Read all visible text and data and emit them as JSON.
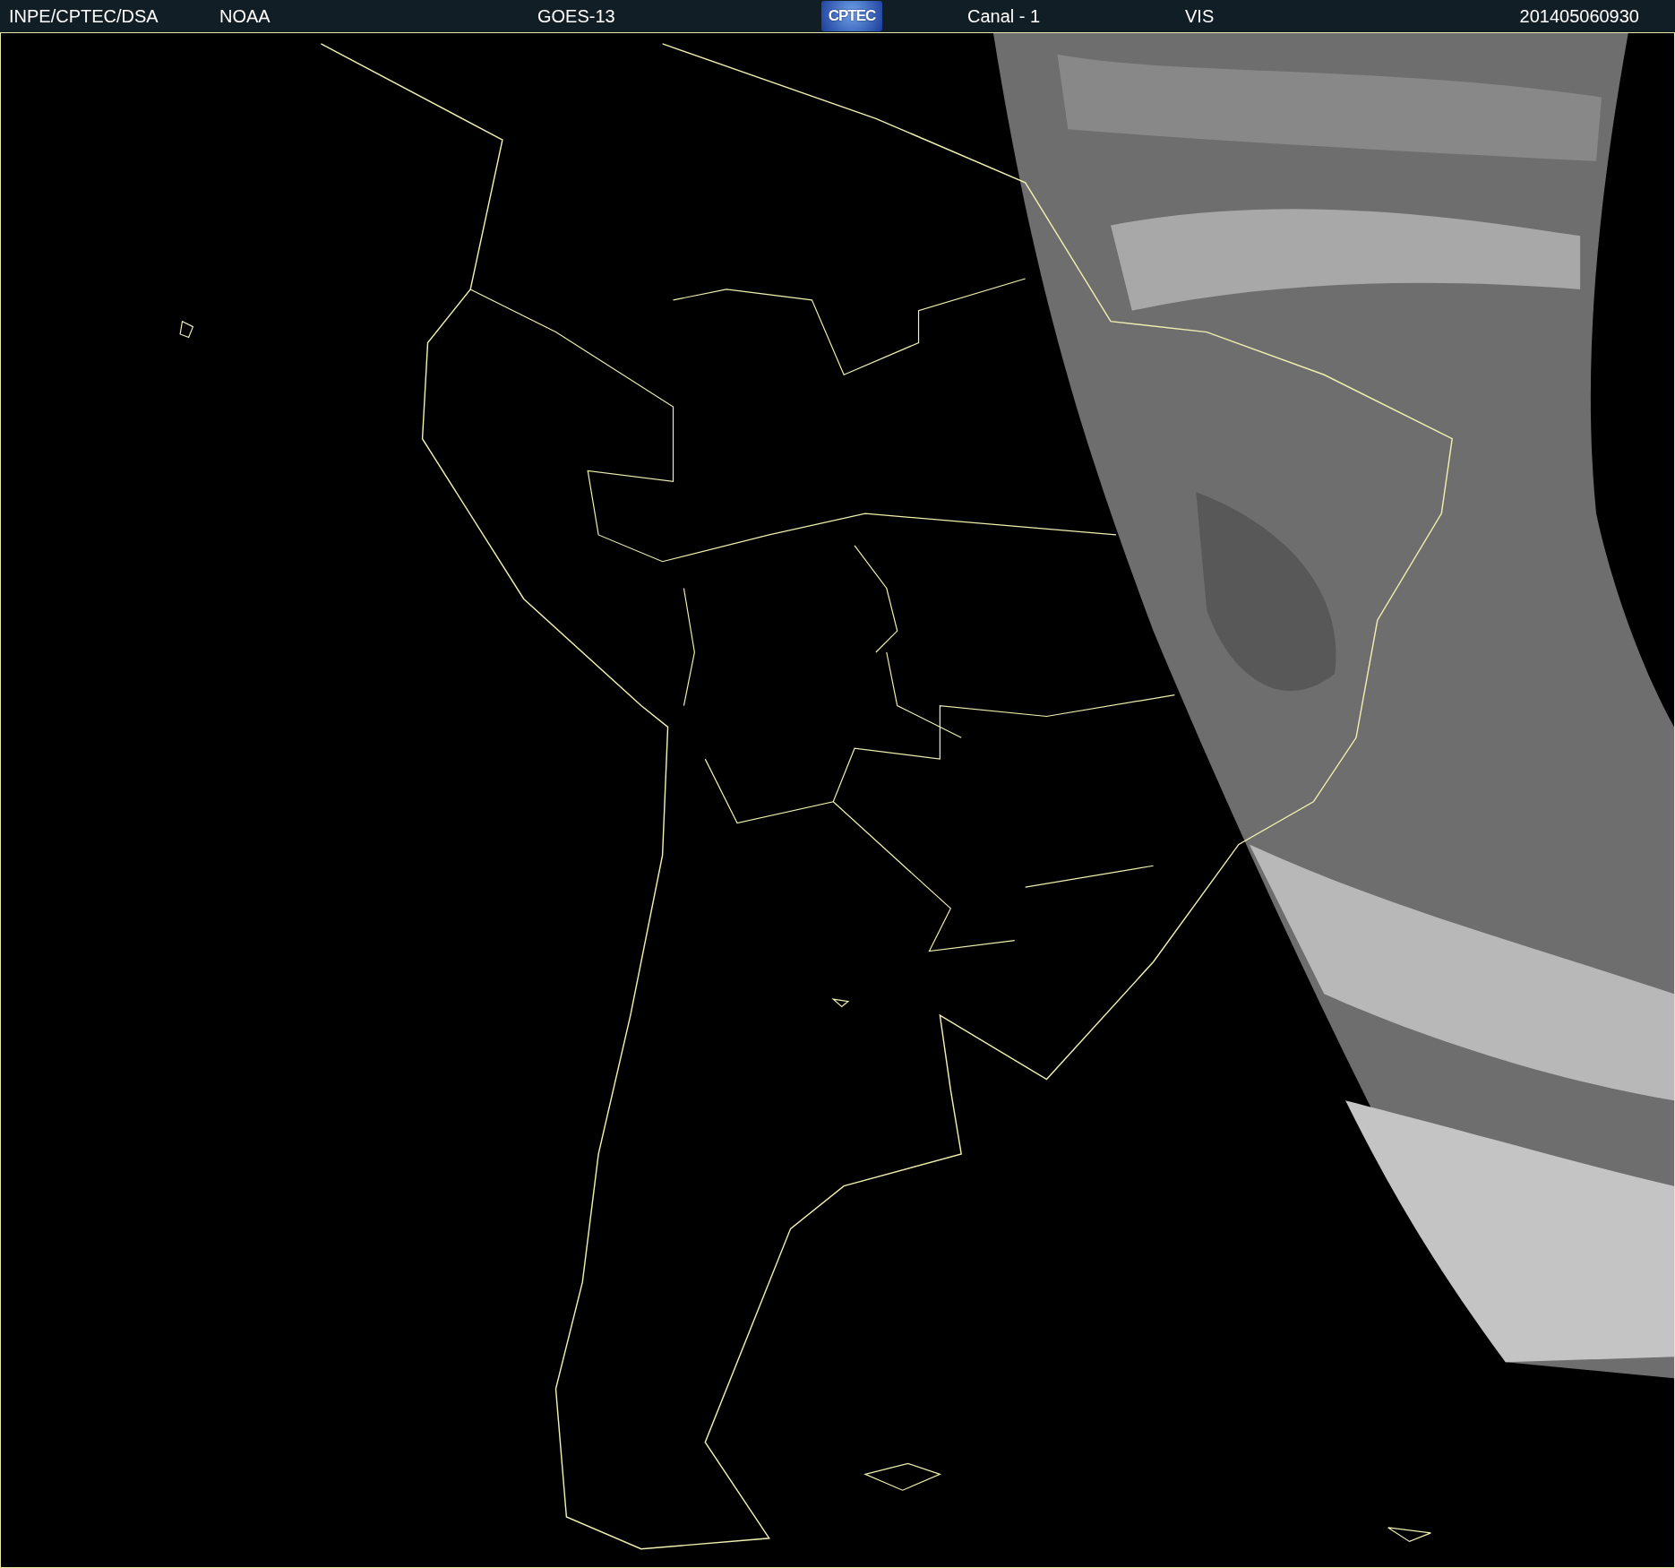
{
  "header": {
    "agency": "INPE/CPTEC/DSA",
    "source": "NOAA",
    "satellite": "GOES-13",
    "logo_text": "CPTEC",
    "channel": "Canal - 1",
    "band": "VIS",
    "timestamp": "201405060930"
  }
}
